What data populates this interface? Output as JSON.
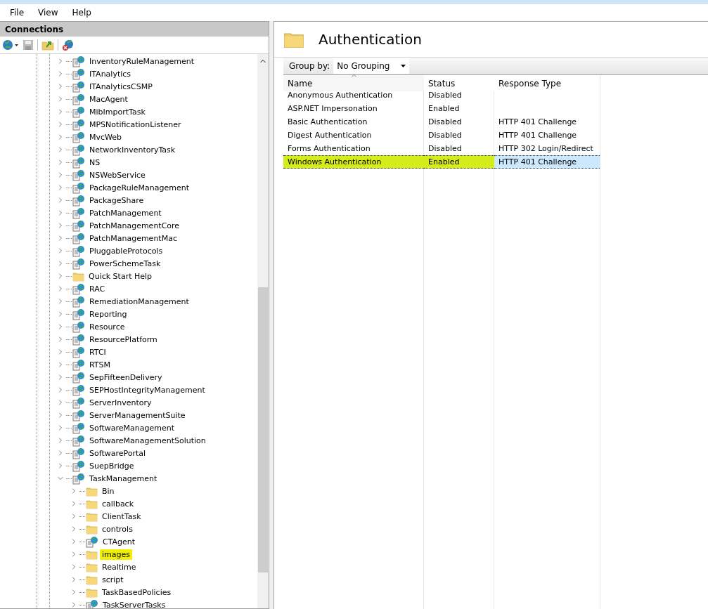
{
  "menu": [
    "File",
    "View",
    "Help"
  ],
  "connections": {
    "title": "Connections",
    "tree": [
      {
        "label": "InventoryRuleManagement",
        "kind": "app",
        "expanded": false,
        "selected": false
      },
      {
        "label": "ITAnalytics",
        "kind": "app",
        "expanded": false,
        "selected": false
      },
      {
        "label": "ITAnalyticsCSMP",
        "kind": "app",
        "expanded": false,
        "selected": false
      },
      {
        "label": "MacAgent",
        "kind": "app",
        "expanded": false,
        "selected": false
      },
      {
        "label": "MibImportTask",
        "kind": "app",
        "expanded": false,
        "selected": false
      },
      {
        "label": "MPSNotificationListener",
        "kind": "app",
        "expanded": false,
        "selected": false
      },
      {
        "label": "MvcWeb",
        "kind": "app",
        "expanded": false,
        "selected": false
      },
      {
        "label": "NetworkInventoryTask",
        "kind": "app",
        "expanded": false,
        "selected": false
      },
      {
        "label": "NS",
        "kind": "app",
        "expanded": false,
        "selected": false
      },
      {
        "label": "NSWebService",
        "kind": "app",
        "expanded": false,
        "selected": false
      },
      {
        "label": "PackageRuleManagement",
        "kind": "app",
        "expanded": false,
        "selected": false
      },
      {
        "label": "PackageShare",
        "kind": "app",
        "expanded": false,
        "selected": false
      },
      {
        "label": "PatchManagement",
        "kind": "app",
        "expanded": false,
        "selected": false
      },
      {
        "label": "PatchManagementCore",
        "kind": "app",
        "expanded": false,
        "selected": false
      },
      {
        "label": "PatchManagementMac",
        "kind": "app",
        "expanded": false,
        "selected": false
      },
      {
        "label": "PluggableProtocols",
        "kind": "app",
        "expanded": false,
        "selected": false
      },
      {
        "label": "PowerSchemeTask",
        "kind": "app",
        "expanded": false,
        "selected": false
      },
      {
        "label": "Quick Start Help",
        "kind": "folder",
        "expanded": false,
        "selected": false
      },
      {
        "label": "RAC",
        "kind": "app",
        "expanded": false,
        "selected": false
      },
      {
        "label": "RemediationManagement",
        "kind": "app",
        "expanded": false,
        "selected": false
      },
      {
        "label": "Reporting",
        "kind": "app",
        "expanded": false,
        "selected": false
      },
      {
        "label": "Resource",
        "kind": "app",
        "expanded": false,
        "selected": false
      },
      {
        "label": "ResourcePlatform",
        "kind": "app",
        "expanded": false,
        "selected": false
      },
      {
        "label": "RTCI",
        "kind": "app",
        "expanded": false,
        "selected": false
      },
      {
        "label": "RTSM",
        "kind": "app",
        "expanded": false,
        "selected": false
      },
      {
        "label": "SepFifteenDelivery",
        "kind": "app",
        "expanded": false,
        "selected": false
      },
      {
        "label": "SEPHostIntegrityManagement",
        "kind": "app",
        "expanded": false,
        "selected": false
      },
      {
        "label": "ServerInventory",
        "kind": "app",
        "expanded": false,
        "selected": false
      },
      {
        "label": "ServerManagementSuite",
        "kind": "app",
        "expanded": false,
        "selected": false
      },
      {
        "label": "SoftwareManagement",
        "kind": "app",
        "expanded": false,
        "selected": false
      },
      {
        "label": "SoftwareManagementSolution",
        "kind": "app",
        "expanded": false,
        "selected": false
      },
      {
        "label": "SoftwarePortal",
        "kind": "app",
        "expanded": false,
        "selected": false
      },
      {
        "label": "SuepBridge",
        "kind": "app",
        "expanded": false,
        "selected": false
      },
      {
        "label": "TaskManagement",
        "kind": "app",
        "expanded": true,
        "selected": false,
        "children": [
          {
            "label": "Bin",
            "kind": "folder",
            "expanded": false,
            "selected": false
          },
          {
            "label": "callback",
            "kind": "folder",
            "expanded": false,
            "selected": false
          },
          {
            "label": "ClientTask",
            "kind": "folder",
            "expanded": false,
            "selected": false
          },
          {
            "label": "controls",
            "kind": "folder",
            "expanded": false,
            "selected": false
          },
          {
            "label": "CTAgent",
            "kind": "app",
            "expanded": false,
            "selected": false
          },
          {
            "label": "images",
            "kind": "folder",
            "expanded": false,
            "selected": true
          },
          {
            "label": "Realtime",
            "kind": "folder",
            "expanded": false,
            "selected": false
          },
          {
            "label": "script",
            "kind": "folder",
            "expanded": false,
            "selected": false
          },
          {
            "label": "TaskBasedPolicies",
            "kind": "folder",
            "expanded": false,
            "selected": false
          },
          {
            "label": "TaskServerTasks",
            "kind": "app",
            "expanded": false,
            "selected": false
          }
        ]
      }
    ]
  },
  "content": {
    "title": "Authentication",
    "group_by": {
      "label": "Group by:",
      "value": "No Grouping"
    },
    "table": {
      "columns": [
        "Name",
        "Status",
        "Response Type"
      ],
      "rows": [
        {
          "cells": [
            "Anonymous Authentication",
            "Disabled",
            null
          ],
          "selected": false
        },
        {
          "cells": [
            "ASP.NET Impersonation",
            "Enabled",
            null
          ],
          "selected": false
        },
        {
          "cells": [
            "Basic Authentication",
            "Disabled",
            "HTTP 401 Challenge"
          ],
          "selected": false
        },
        {
          "cells": [
            "Digest Authentication",
            "Disabled",
            "HTTP 401 Challenge"
          ],
          "selected": false
        },
        {
          "cells": [
            "Forms Authentication",
            "Disabled",
            "HTTP 302 Login/Redirect"
          ],
          "selected": false
        },
        {
          "cells": [
            "Windows Authentication",
            "Enabled",
            "HTTP 401 Challenge"
          ],
          "selected": true
        }
      ]
    }
  }
}
